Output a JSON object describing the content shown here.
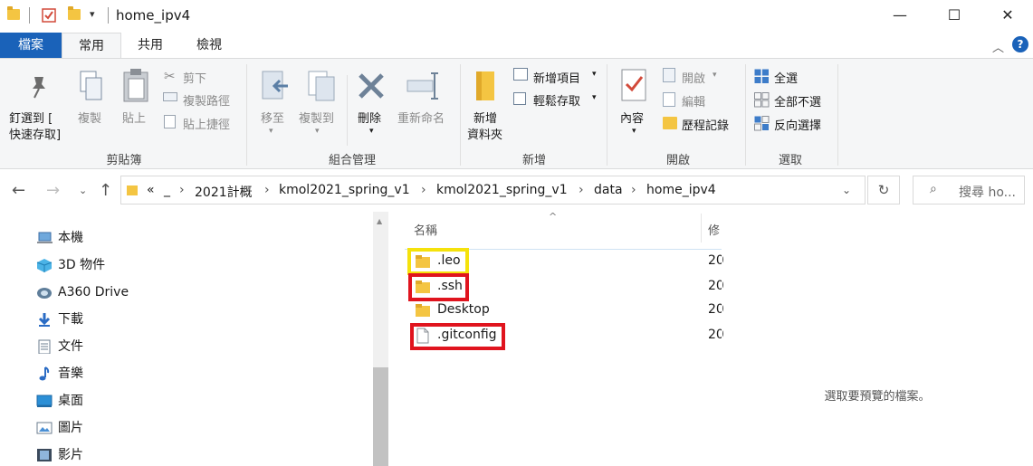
{
  "window": {
    "title": "home_ipv4",
    "controls": {
      "minimize": "—",
      "maximize": "☐",
      "close": "✕"
    }
  },
  "tabs": [
    {
      "label": "檔案"
    },
    {
      "label": "常用"
    },
    {
      "label": "共用"
    },
    {
      "label": "檢視"
    }
  ],
  "ribbon": {
    "clipboard": {
      "label": "剪貼簿",
      "pin_line1": "釘選到 [",
      "pin_line2": "快速存取]",
      "copy": "複製",
      "paste": "貼上",
      "cut": "剪下",
      "copy_path": "複製路徑",
      "paste_shortcut": "貼上捷徑"
    },
    "organize": {
      "label": "組合管理",
      "move_to": "移至",
      "copy_to": "複製到",
      "delete": "刪除",
      "rename": "重新命名"
    },
    "new": {
      "label": "新增",
      "new_folder_line1": "新增",
      "new_folder_line2": "資料夾",
      "new_item": "新增項目",
      "easy_access": "輕鬆存取"
    },
    "open": {
      "label": "開啟",
      "properties": "內容",
      "open": "開啟",
      "edit": "編輯",
      "history": "歷程記錄"
    },
    "select": {
      "label": "選取",
      "select_all": "全選",
      "select_none": "全部不選",
      "invert": "反向選擇"
    }
  },
  "address": {
    "overflow": "«",
    "crumbs": [
      "_",
      "2021計概",
      "kmol2021_spring_v1",
      "kmol2021_spring_v1",
      "data",
      "home_ipv4"
    ],
    "search_placeholder": "搜尋 ho..."
  },
  "nav_pane": [
    {
      "label": "本機",
      "icon": "this-pc-icon"
    },
    {
      "label": "3D 物件",
      "icon": "3d-objects-icon"
    },
    {
      "label": "A360 Drive",
      "icon": "a360-drive-icon"
    },
    {
      "label": "下載",
      "icon": "downloads-icon"
    },
    {
      "label": "文件",
      "icon": "documents-icon"
    },
    {
      "label": "音樂",
      "icon": "music-icon"
    },
    {
      "label": "桌面",
      "icon": "desktop-icon"
    },
    {
      "label": "圖片",
      "icon": "pictures-icon"
    },
    {
      "label": "影片",
      "icon": "videos-icon"
    }
  ],
  "file_list": {
    "col_name": "名稱",
    "col_modified": "修",
    "rows": [
      {
        "name": ".leo",
        "type": "folder",
        "date": "20",
        "highlight": "#f5e20c"
      },
      {
        "name": ".ssh",
        "type": "folder",
        "date": "20",
        "highlight": "#e0141e"
      },
      {
        "name": "Desktop",
        "type": "folder",
        "date": "20",
        "highlight": ""
      },
      {
        "name": ".gitconfig",
        "type": "file",
        "date": "20",
        "highlight": "#e0141e"
      }
    ]
  },
  "preview": {
    "message": "選取要預覽的檔案。"
  },
  "colors": {
    "file_tab": "#1a62b9",
    "folder": "#f4c542",
    "ribbon_bg": "#f5f6f7"
  }
}
